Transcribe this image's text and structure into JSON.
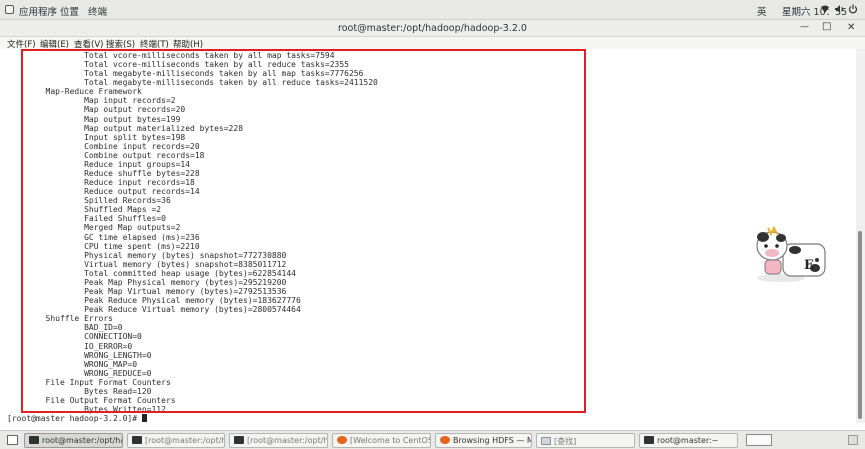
{
  "topbar": {
    "apps_label": "应用程序",
    "places_label": "位置",
    "terminal_label": "终端",
    "ime_label": "英",
    "clock": "星期六 10：55",
    "network_icon": "network-icon",
    "volume_icon": "volume-icon",
    "power_icon": "power-icon"
  },
  "window": {
    "title": "root@master:/opt/hadoop/hadoop-3.2.0",
    "minimize_glyph": "—",
    "maximize_glyph": "□",
    "close_glyph": "✕"
  },
  "menubar": {
    "file": "文件(F)",
    "edit": "编辑(E)",
    "view": "查看(V)",
    "search": "搜索(S)",
    "terminal": "终端(T)",
    "help": "帮助(H)"
  },
  "terminal": {
    "lines": [
      "\t\tTotal vcore-milliseconds taken by all map tasks=7594",
      "\t\tTotal vcore-milliseconds taken by all reduce tasks=2355",
      "\t\tTotal megabyte-milliseconds taken by all map tasks=7776256",
      "\t\tTotal megabyte-milliseconds taken by all reduce tasks=2411520",
      "\tMap-Reduce Framework",
      "\t\tMap input records=2",
      "\t\tMap output records=20",
      "\t\tMap output bytes=199",
      "\t\tMap output materialized bytes=228",
      "\t\tInput split bytes=198",
      "\t\tCombine input records=20",
      "\t\tCombine output records=18",
      "\t\tReduce input groups=14",
      "\t\tReduce shuffle bytes=228",
      "\t\tReduce input records=18",
      "\t\tReduce output records=14",
      "\t\tSpilled Records=36",
      "\t\tShuffled Maps =2",
      "\t\tFailed Shuffles=0",
      "\t\tMerged Map outputs=2",
      "\t\tGC time elapsed (ms)=236",
      "\t\tCPU time spent (ms)=2210",
      "\t\tPhysical memory (bytes) snapshot=772730880",
      "\t\tVirtual memory (bytes) snapshot=8385011712",
      "\t\tTotal committed heap usage (bytes)=622854144",
      "\t\tPeak Map Physical memory (bytes)=295219200",
      "\t\tPeak Map Virtual memory (bytes)=2792513536",
      "\t\tPeak Reduce Physical memory (bytes)=183627776",
      "\t\tPeak Reduce Virtual memory (bytes)=2800574464",
      "\tShuffle Errors",
      "\t\tBAD_ID=0",
      "\t\tCONNECTION=0",
      "\t\tIO_ERROR=0",
      "\t\tWRONG_LENGTH=0",
      "\t\tWRONG_MAP=0",
      "\t\tWRONG_REDUCE=0",
      "\tFile Input Format Counters ",
      "\t\tBytes Read=120",
      "\tFile Output Format Counters ",
      "\t\tBytes Written=112"
    ],
    "prompt": "[root@master hadoop-3.2.0]# "
  },
  "taskbar": {
    "items": [
      {
        "label": "root@master:/opt/hado...",
        "icon": "terminal-icon",
        "state": "active"
      },
      {
        "label": "[root@master:/opt/hado...",
        "icon": "terminal-icon",
        "state": "inactive"
      },
      {
        "label": "[root@master:/opt/hado...",
        "icon": "terminal-icon",
        "state": "inactive"
      },
      {
        "label": "[Welcome to CentOS — ...",
        "icon": "firefox-icon",
        "state": "inactive"
      },
      {
        "label": "Browsing HDFS — Mozil...",
        "icon": "firefox-icon",
        "state": "normal"
      },
      {
        "label": "[查找]",
        "icon": "search-window-icon",
        "state": "inactive"
      },
      {
        "label": "root@master:~",
        "icon": "terminal-icon",
        "state": "normal"
      }
    ]
  },
  "mascot": {
    "badge_letter": "E"
  }
}
